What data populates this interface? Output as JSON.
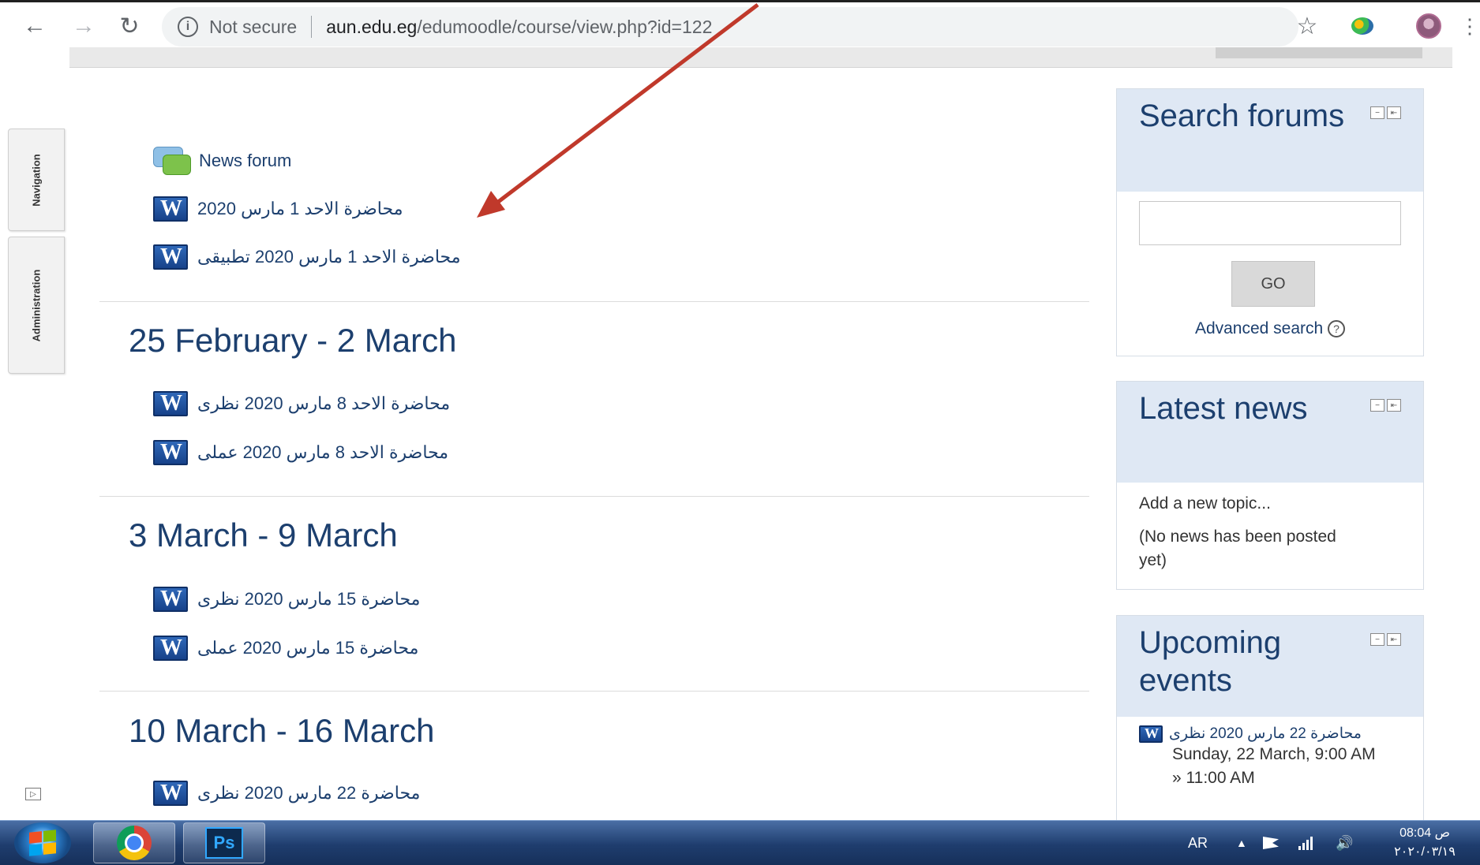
{
  "browser": {
    "security_label": "Not secure",
    "url_host": "aun.edu.eg",
    "url_path": "/edumoodle/course/view.php?id=122"
  },
  "dock": {
    "navigation_label": "Navigation",
    "administration_label": "Administration"
  },
  "course": {
    "top_activities": [
      {
        "label": "News forum",
        "icon": "forum-icon"
      },
      {
        "label": "محاضرة الاحد 1 مارس 2020",
        "icon": "word-doc-icon"
      },
      {
        "label": "محاضرة الاحد 1 مارس 2020 تطبيقى",
        "icon": "word-doc-icon"
      }
    ],
    "sections": [
      {
        "title": "25 February - 2 March",
        "activities": [
          {
            "label": "محاضرة الاحد 8 مارس 2020 نظرى"
          },
          {
            "label": "محاضرة الاحد 8 مارس 2020 عملى"
          }
        ]
      },
      {
        "title": "3 March - 9 March",
        "activities": [
          {
            "label": "محاضرة 15 مارس 2020 نظرى"
          },
          {
            "label": "محاضرة 15 مارس 2020 عملى"
          }
        ]
      },
      {
        "title": "10 March - 16 March",
        "activities": [
          {
            "label": "محاضرة 22 مارس 2020 نظرى"
          }
        ]
      }
    ]
  },
  "blocks": {
    "search_forums": {
      "title": "Search forums",
      "go_label": "GO",
      "advanced_search": "Advanced search"
    },
    "latest_news": {
      "title": "Latest news",
      "add_topic": "Add a new topic...",
      "empty_text": "(No news has been posted yet)"
    },
    "upcoming_events": {
      "title": "Upcoming events",
      "event_name": "محاضرة 22 مارس 2020 نظرى",
      "event_date": "Sunday, 22 March, 9:00 AM",
      "event_end": "» 11:00 AM"
    }
  },
  "taskbar": {
    "ps_label": "Ps",
    "language": "AR",
    "time": "08:04 ص",
    "date": "٢٠٢٠/٠٣/١٩"
  },
  "colors": {
    "link": "#1c3f6e",
    "block_header": "#dfe8f4",
    "arrow": "#c0392b"
  }
}
